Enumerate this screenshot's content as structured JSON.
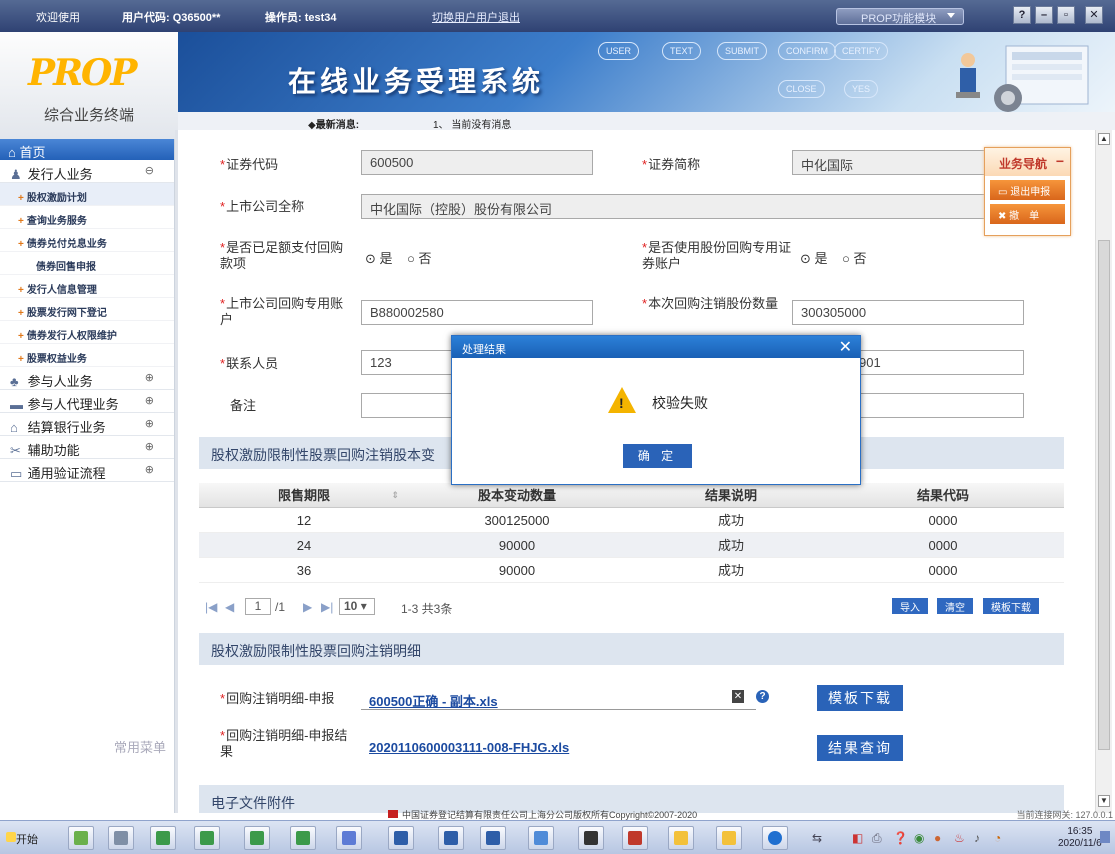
{
  "topbar": {
    "welcome": "欢迎使用",
    "user_code": "用户代码: Q36500**",
    "operator": "操作员: test34",
    "switch_user": "切换用户",
    "logout": "用户退出",
    "module_select": "PROP功能模块",
    "win_buttons": [
      "?",
      "–",
      "▫",
      "✕"
    ]
  },
  "logo": {
    "mark": "PROP",
    "subtitle": "综合业务终端"
  },
  "banner": {
    "title": "在线业务受理系统",
    "flow": [
      "USER",
      "TEXT",
      "SUBMIT",
      "CONFIRM",
      "CERTIFY",
      "CLOSE",
      "YES"
    ]
  },
  "news": {
    "label": "◆最新消息:",
    "item": "1、 当前没有消息"
  },
  "sidebar": {
    "home": "首页",
    "categories": [
      {
        "label": "发行人业务",
        "icon": "person-icon",
        "toggle": "⊖"
      },
      {
        "label": "参与人业务",
        "icon": "people-icon",
        "toggle": "⊕"
      },
      {
        "label": "参与人代理业务",
        "icon": "monitor-icon",
        "toggle": "⊕"
      },
      {
        "label": "结算银行业务",
        "icon": "bank-icon",
        "toggle": "⊕"
      },
      {
        "label": "辅助功能",
        "icon": "tools-icon",
        "toggle": "⊕"
      },
      {
        "label": "通用验证流程",
        "icon": "folder-icon",
        "toggle": "⊕"
      }
    ],
    "sub_items": [
      "股权激励计划",
      "查询业务服务",
      "债券兑付兑息业务",
      "债券回售申报",
      "发行人信息管理",
      "股票发行网下登记",
      "债券发行人权限维护",
      "股票权益业务"
    ],
    "common_menu": "常用菜单"
  },
  "form": {
    "security_code_label": "证券代码",
    "security_code": "600500",
    "security_abbr_label": "证券简称",
    "security_abbr": "中化国际",
    "company_name_label": "上市公司全称",
    "company_name": "中化国际（控股）股份有限公司",
    "paid_label": "是否已足额支付回购款项",
    "use_account_label": "是否使用股份回购专用证券账户",
    "yes": "是",
    "no": "否",
    "account_label": "上市公司回购专用账户",
    "account": "B880002580",
    "cancel_shares_label": "本次回购注销股份数量",
    "cancel_shares": "300305000",
    "contact_label": "联系人员",
    "contact": "123",
    "contact_phone_tail": "901",
    "remark_label": "备注"
  },
  "section1": {
    "title": "股权激励限制性股票回购注销股本变"
  },
  "table": {
    "headers": [
      "限售期限",
      "股本变动数量",
      "结果说明",
      "结果代码"
    ],
    "rows": [
      [
        "12",
        "300125000",
        "成功",
        "0000"
      ],
      [
        "24",
        "90000",
        "成功",
        "0000"
      ],
      [
        "36",
        "90000",
        "成功",
        "0000"
      ]
    ]
  },
  "pager": {
    "page": "1",
    "total_pages": "/1",
    "page_size": "10",
    "summary": "1-3  共3条",
    "import": "导入",
    "clear": "清空",
    "template_download": "模板下载"
  },
  "section2": {
    "title": "股权激励限制性股票回购注销明细"
  },
  "detail": {
    "apply_label": "回购注销明细-申报",
    "apply_file": "600500正确 - 副本.xls",
    "template_btn": "模板下载",
    "result_label": "回购注销明细-申报结果",
    "result_file": "2020110600003111-008-FHJG.xls",
    "result_btn": "结果查询"
  },
  "section3": {
    "title": "电子文件附件"
  },
  "navbox": {
    "title": "业务导航",
    "exit": "退出申报",
    "cancel": "撤　单"
  },
  "modal": {
    "title": "处理结果",
    "message": "校验失败",
    "ok": "确 定"
  },
  "footer": {
    "copyright": "中国证券登记结算有限责任公司上海分公司版权所有Copyright©2007-2020",
    "connection": "当前连接网关: 127.0.0.1"
  },
  "taskbar": {
    "start": "开始",
    "time": "16:35",
    "date": "2020/11/6"
  }
}
